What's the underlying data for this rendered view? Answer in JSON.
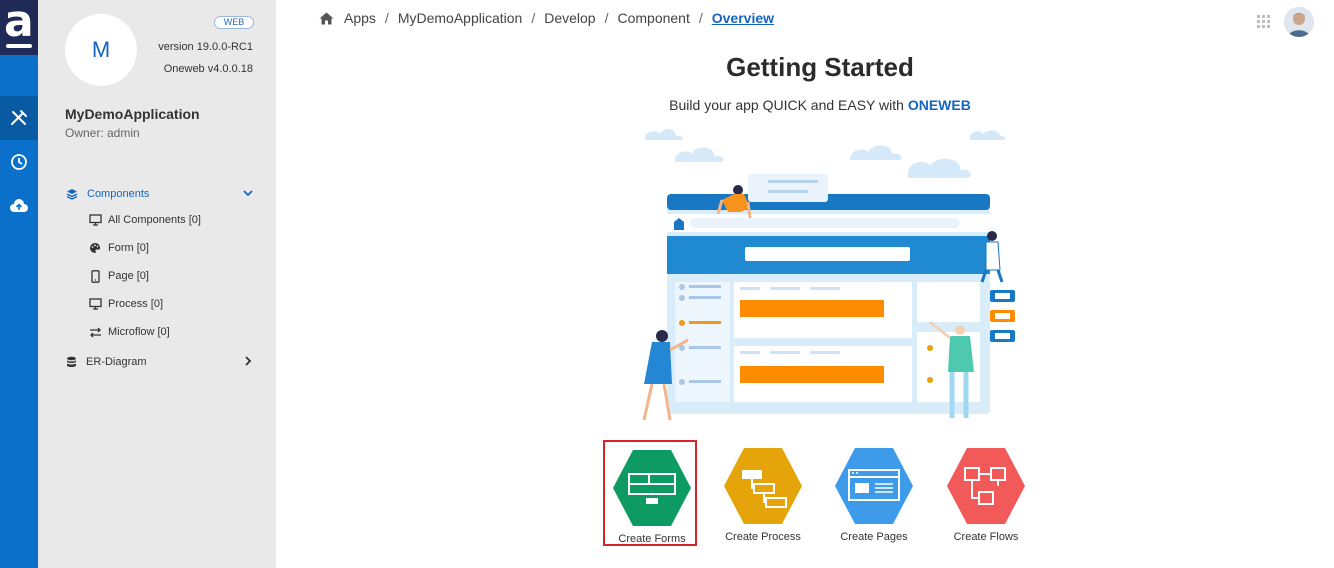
{
  "brand": {
    "logo_letter": "a"
  },
  "rail": {
    "icons": [
      "tools-icon",
      "history-icon",
      "cloud-upload-icon"
    ]
  },
  "sidebar": {
    "avatar_letter": "M",
    "badge": "WEB",
    "version": "version 19.0.0-RC1",
    "oneweb_version": "Oneweb v4.0.0.18",
    "app_name": "MyDemoApplication",
    "owner": "Owner: admin",
    "components_label": "Components",
    "items": [
      {
        "label": "All Components [0]",
        "icon": "monitor-icon"
      },
      {
        "label": "Form [0]",
        "icon": "palette-icon"
      },
      {
        "label": "Page [0]",
        "icon": "mobile-icon"
      },
      {
        "label": "Process [0]",
        "icon": "monitor-icon"
      },
      {
        "label": "Microflow [0]",
        "icon": "exchange-icon"
      }
    ],
    "er_label": "ER-Diagram"
  },
  "breadcrumb": {
    "items": [
      "Apps",
      "MyDemoApplication",
      "Develop",
      "Component"
    ],
    "current": "Overview",
    "separator": "/"
  },
  "main": {
    "title": "Getting Started",
    "subtitle_prefix": "Build your app QUICK and EASY with ",
    "subtitle_brand": "ONEWEB",
    "actions": [
      {
        "label": "Create Forms",
        "color": "#0e9a63",
        "selected": true
      },
      {
        "label": "Create Process",
        "color": "#e5a50a",
        "selected": false
      },
      {
        "label": "Create Pages",
        "color": "#3d9be9",
        "selected": false
      },
      {
        "label": "Create Flows",
        "color": "#f25a5a",
        "selected": false
      }
    ]
  },
  "colors": {
    "accent": "#1565c0",
    "rail": "#0a70c9",
    "selection": "#d9232a"
  }
}
